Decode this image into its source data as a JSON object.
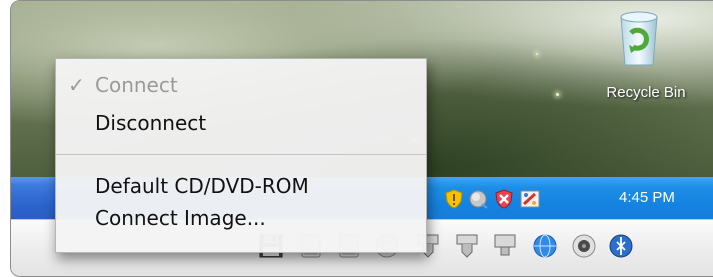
{
  "desktop": {
    "recycle_bin_label": "Recycle Bin"
  },
  "context_menu": {
    "items": [
      {
        "label": "Connect",
        "checked": true,
        "enabled": false
      },
      {
        "label": "Disconnect",
        "checked": false,
        "enabled": true
      },
      {
        "label": "Default CD/DVD-ROM",
        "checked": false,
        "enabled": true
      },
      {
        "label": "Connect Image...",
        "checked": false,
        "enabled": true
      }
    ],
    "check_glyph": "✓"
  },
  "taskbar": {
    "tray_icons": [
      "security-shield-icon",
      "network-icon",
      "security-alert-icon",
      "paint-icon"
    ],
    "clock": "4:45 PM"
  },
  "status_bar": {
    "device_icons": [
      "floppy-disk-icon",
      "hard-disk-icon",
      "hard-disk-icon",
      "cd-dvd-icon",
      "usb-device-icon",
      "usb-device-icon",
      "network-adapter-icon",
      "network-globe-icon",
      "sound-icon",
      "usb-bluetooth-icon"
    ]
  },
  "colors": {
    "taskbar_blue": "#2b63cc",
    "tray_blue": "#1382e0",
    "menu_bg": "#f4f4f4",
    "menu_disabled_text": "#9a9a9a"
  }
}
